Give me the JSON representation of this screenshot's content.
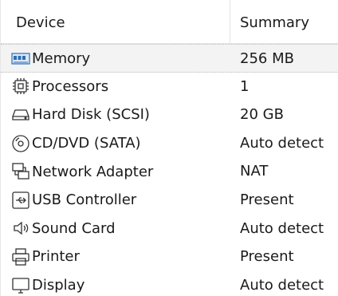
{
  "table": {
    "columns": {
      "device": "Device",
      "summary": "Summary"
    },
    "rows": [
      {
        "device": "Memory",
        "summary": "256 MB",
        "icon": "memory-icon",
        "selected": true
      },
      {
        "device": "Processors",
        "summary": "1",
        "icon": "processor-icon"
      },
      {
        "device": "Hard Disk (SCSI)",
        "summary": "20 GB",
        "icon": "hard-disk-icon"
      },
      {
        "device": "CD/DVD (SATA)",
        "summary": "Auto detect",
        "icon": "cd-dvd-icon"
      },
      {
        "device": "Network Adapter",
        "summary": "NAT",
        "icon": "network-adapter-icon"
      },
      {
        "device": "USB Controller",
        "summary": "Present",
        "icon": "usb-icon"
      },
      {
        "device": "Sound Card",
        "summary": "Auto detect",
        "icon": "speaker-icon"
      },
      {
        "device": "Printer",
        "summary": "Present",
        "icon": "printer-icon"
      },
      {
        "device": "Display",
        "summary": "Auto detect",
        "icon": "monitor-icon"
      }
    ]
  },
  "colors": {
    "selection_background": "#f3f3f3",
    "memory_icon_accent": "#2f6db5"
  }
}
